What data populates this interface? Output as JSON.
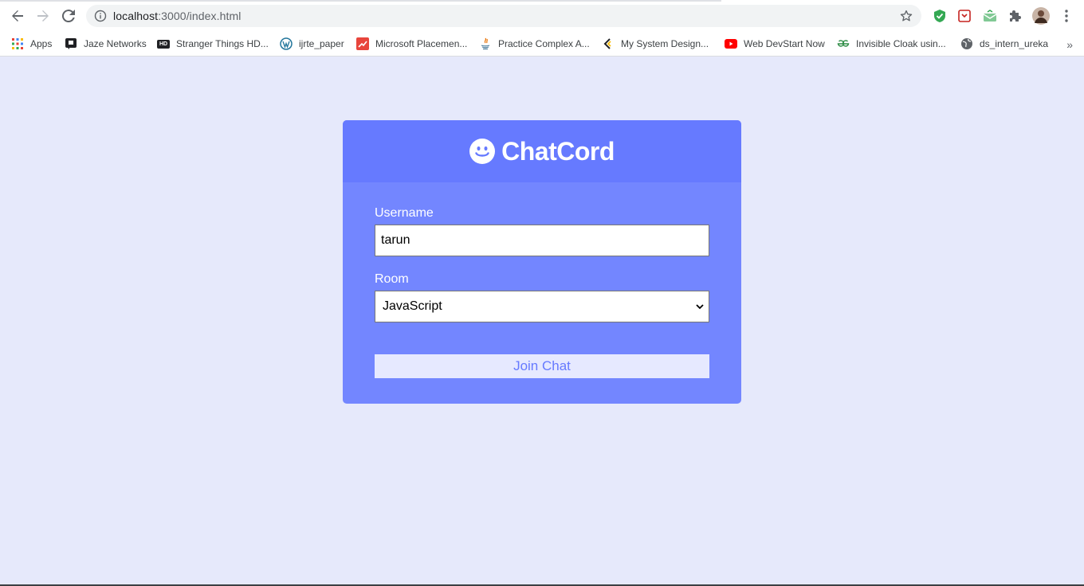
{
  "browser": {
    "url_host": "localhost",
    "url_rest": ":3000/index.html",
    "bookmarks": [
      {
        "label": "Apps",
        "icon": "apps-grid-icon",
        "color": "#e94235"
      },
      {
        "label": "Jaze Networks",
        "icon": "jaze-icon",
        "color": "#202124"
      },
      {
        "label": "Stranger Things HD...",
        "icon": "hd-icon",
        "color": "#202124"
      },
      {
        "label": "ijrte_paper",
        "icon": "wordpress-icon",
        "color": "#21759b"
      },
      {
        "label": "Microsoft Placemen...",
        "icon": "microsoft-placement-icon",
        "color": "#f25022"
      },
      {
        "label": "Practice Complex A...",
        "icon": "java-icon",
        "color": "#e76f00"
      },
      {
        "label": "My System Design...",
        "icon": "system-design-icon",
        "color": "#202124"
      },
      {
        "label": "Web DevStart Now",
        "icon": "youtube-icon",
        "color": "#ff0000"
      },
      {
        "label": "Invisible Cloak usin...",
        "icon": "geeksforgeeks-icon",
        "color": "#2f8d46"
      },
      {
        "label": "ds_intern_ureka",
        "icon": "globe-icon",
        "color": "#5f6368"
      }
    ]
  },
  "header": {
    "title": "ChatCord"
  },
  "form": {
    "username_label": "Username",
    "username_value": "tarun",
    "room_label": "Room",
    "room_value": "JavaScript",
    "join_label": "Join Chat"
  },
  "colors": {
    "page_bg": "#e6e9fb",
    "header_bg": "#667aff",
    "panel_bg": "#7386ff",
    "button_bg": "#e6e9ff"
  }
}
